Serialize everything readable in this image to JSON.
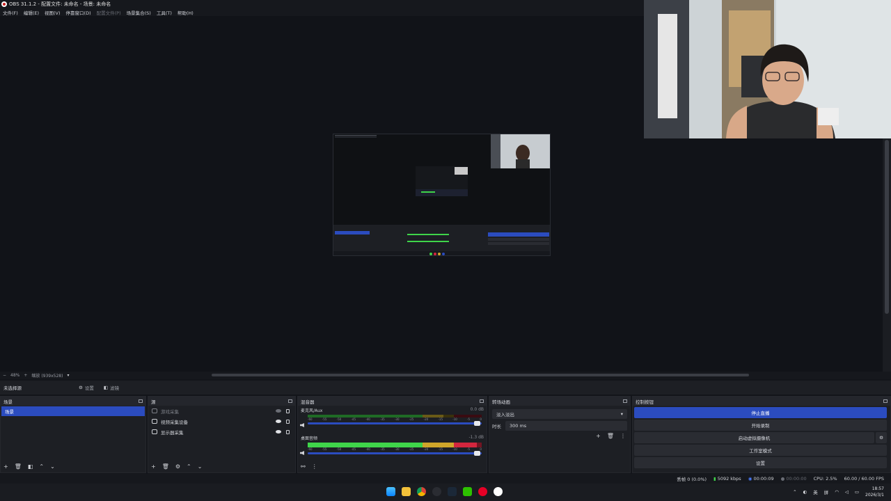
{
  "window": {
    "title": "OBS 31.1.2 - 配置文件: 未命名 - 场景: 未命名"
  },
  "menu": [
    "文件(F)",
    "编辑(E)",
    "视图(V)",
    "停靠窗口(D)",
    "配置文件(P)",
    "场景集合(S)",
    "工具(T)",
    "帮助(H)"
  ],
  "zoom": {
    "level": "48%",
    "mode": "缩放 (939x528)"
  },
  "context": {
    "no_selection": "未选择源",
    "settings": "设置",
    "filters": "滤镜"
  },
  "docks": {
    "scenes": {
      "title": "场景",
      "items": [
        "场景"
      ]
    },
    "sources": {
      "title": "源",
      "items": [
        "游戏采集",
        "视频采集设备",
        "显示器采集"
      ]
    },
    "mixer": {
      "title": "混音器",
      "channels": [
        {
          "name": "麦克风/Aux",
          "db": "0.0 dB",
          "level": 0.78
        },
        {
          "name": "桌面音频",
          "db": "-1.3 dB",
          "level": 0.97
        }
      ],
      "scale": [
        "-60",
        "-55",
        "-50",
        "-45",
        "-40",
        "-35",
        "-30",
        "-25",
        "-20",
        "-15",
        "-10",
        "-5",
        "0"
      ]
    },
    "transitions": {
      "title": "转场动画",
      "selected": "淡入淡出",
      "duration_label": "时长",
      "duration_value": "300 ms"
    },
    "controls": {
      "title": "控制按钮",
      "buttons": [
        "停止直播",
        "开始录制",
        "启动虚拟摄像机",
        "工作室模式",
        "设置"
      ]
    }
  },
  "status": {
    "frames": "丢帧 0 (0.0%)",
    "bitrate": "5092 kbps",
    "stream_time": "00:00:09",
    "rec_time": "00:00:00",
    "cpu": "CPU: 2.5%",
    "fps": "60.00 / 60.00 FPS"
  },
  "tray": {
    "lang": "英",
    "ime": "拼",
    "time": "18:57",
    "date": "2026/3/1"
  },
  "colors": {
    "accent": "#2b4cbf",
    "meter_green": "#3fd54a",
    "meter_yellow": "#cfa52a",
    "meter_red": "#d4263e"
  }
}
